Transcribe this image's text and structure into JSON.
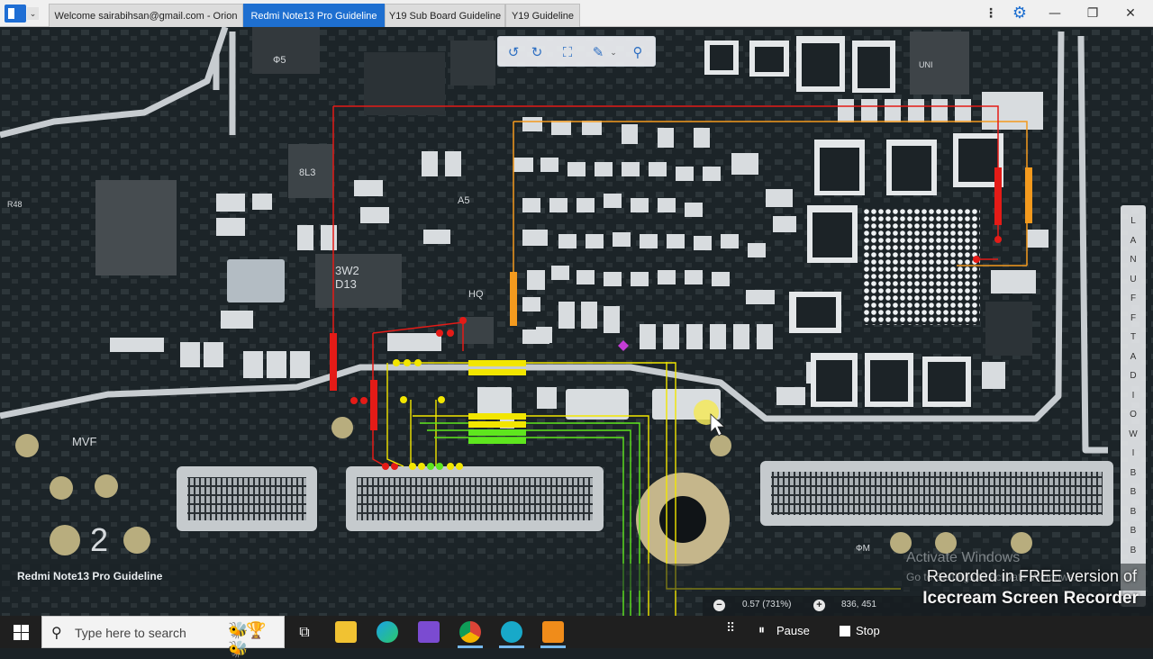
{
  "window": {
    "menu_glyph": "⌄",
    "tabs": [
      {
        "label": "Welcome sairabihsan@gmail.com - Orion",
        "active": false
      },
      {
        "label": "Redmi Note13 Pro Guideline",
        "active": true
      },
      {
        "label": "Y19 Sub Board Guideline",
        "active": false
      },
      {
        "label": "Y19 Guideline",
        "active": false
      }
    ],
    "icons": {
      "kebab": "⋮",
      "settings": "⚙",
      "minimize": "—",
      "maximize": "❐",
      "close": "✕"
    }
  },
  "viewer": {
    "toolbar_icons": {
      "rotate_left": "↺",
      "rotate_right": "↻",
      "fit": "⛶",
      "tools": "✎",
      "tools_caret": "⌄",
      "search": "⚲"
    },
    "board_name": "Redmi Note13 Pro Guideline",
    "net_panel_letters": [
      "L",
      "A",
      "N",
      "U",
      "F",
      "F",
      "T",
      "A",
      "D",
      "I",
      "O",
      "W",
      "I",
      "B",
      "B",
      "B",
      "B",
      "B"
    ],
    "pcb_labels": [
      "Ф5",
      "A5",
      "UNI",
      "8L3",
      "D13",
      "3W2",
      "HQ",
      "MVF",
      "2",
      "ФМ",
      "R48"
    ],
    "zoom": {
      "minus": "−",
      "value": "0.57 (731%)",
      "plus": "+",
      "coords": "836, 451"
    },
    "watermark": {
      "title": "Activate Windows",
      "subtitle": "Go to Settings to activate Windows."
    },
    "recorder_banner": {
      "line1": "Recorded in FREE version of",
      "line2": "Icecream Screen Recorder"
    }
  },
  "taskbar": {
    "search_placeholder": "Type here to search",
    "search_glyph": "⚲",
    "search_deco": "🐝🏆🐝",
    "task_view_glyph": "⧉"
  },
  "recorder_controls": {
    "drag_glyph": "⠿",
    "pause_glyph": "⏸",
    "pause_label": "Pause",
    "stop_label": "Stop"
  },
  "colors": {
    "accent": "#1e6fd0",
    "trace_red": "#e41b17",
    "trace_orange": "#f39a1e",
    "trace_yellow": "#f2e600",
    "trace_green": "#5ee61e",
    "board": "#1c2428",
    "silver": "#c9ced2"
  }
}
